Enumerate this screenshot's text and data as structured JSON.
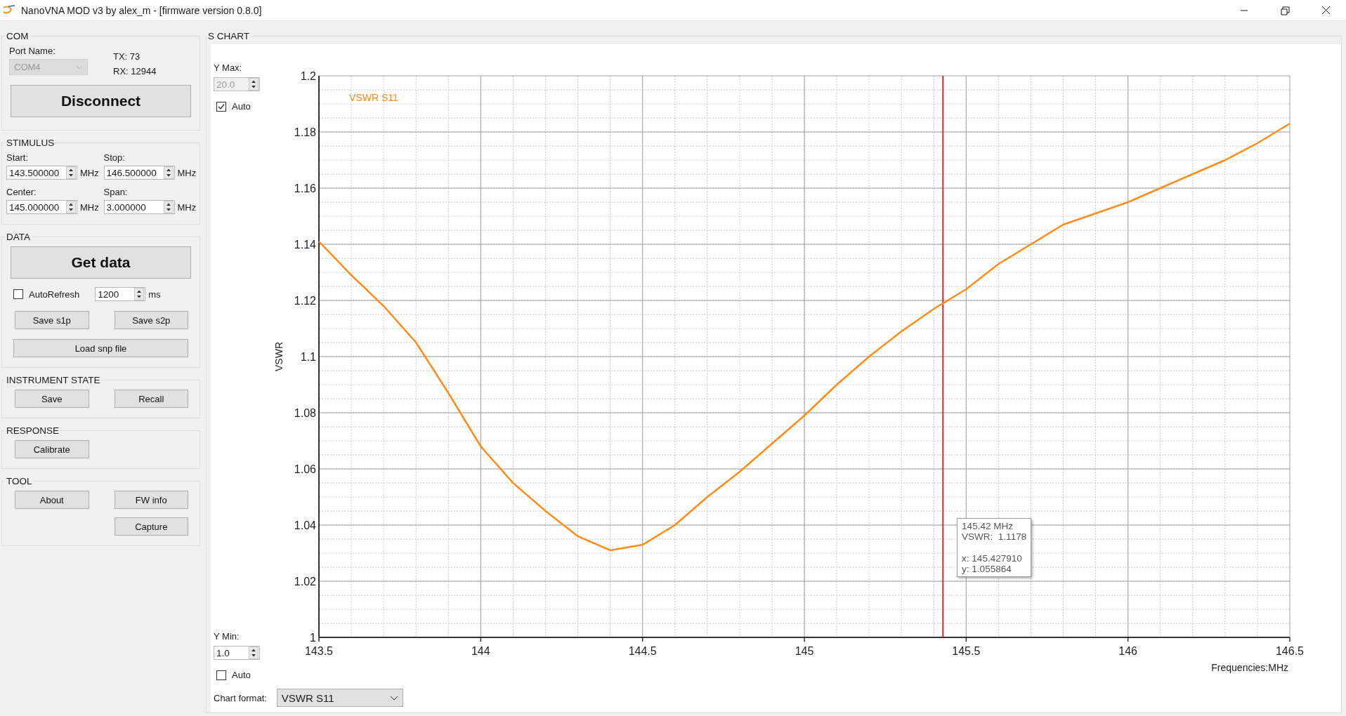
{
  "window": {
    "title": "NanoVNA MOD v3 by alex_m - [firmware version 0.8.0]"
  },
  "com": {
    "title": "COM",
    "port_label": "Port Name:",
    "port_value": "COM4",
    "port_disabled": true,
    "tx": "TX: 73",
    "rx": "RX: 12944",
    "button": "Disconnect"
  },
  "stimulus": {
    "title": "STIMULUS",
    "fields": [
      {
        "label": "Start:",
        "value": "143.500000",
        "unit": "MHz"
      },
      {
        "label": "Stop:",
        "value": "146.500000",
        "unit": "MHz"
      },
      {
        "label": "Center:",
        "value": "145.000000",
        "unit": "MHz"
      },
      {
        "label": "Span:",
        "value": "3.000000",
        "unit": "MHz"
      }
    ]
  },
  "data": {
    "title": "DATA",
    "get_button": "Get data",
    "autorefresh": {
      "label": "AutoRefresh",
      "checked": false
    },
    "interval": {
      "value": "1200",
      "unit": "ms"
    },
    "save_buttons": [
      "Save s1p",
      "Save s2p"
    ],
    "load_button": "Load snp file"
  },
  "instrument_state": {
    "title": "INSTRUMENT STATE",
    "buttons": [
      "Save",
      "Recall"
    ]
  },
  "response": {
    "title": "RESPONSE",
    "buttons": [
      "Calibrate"
    ]
  },
  "tool": {
    "title": "TOOL",
    "rows": [
      {
        "left": "About",
        "right": "FW info"
      },
      {
        "right": "Capture"
      }
    ]
  },
  "chart_panel": {
    "title": "S CHART",
    "y_max": {
      "label": "Y Max:",
      "value": "20.0",
      "disabled": true,
      "auto_label": "Auto",
      "auto_checked": true
    },
    "y_min": {
      "label": "Y Min:",
      "value": "1.0",
      "disabled": false,
      "auto_label": "Auto",
      "auto_checked": false
    },
    "chart_data": {
      "type": "line",
      "xlabel": "Frequencies:MHz",
      "ylabel": "VSWR",
      "x": [
        143.5,
        143.6,
        143.7,
        143.8,
        143.9,
        144.0,
        144.1,
        144.2,
        144.3,
        144.4,
        144.5,
        144.6,
        144.7,
        144.8,
        144.9,
        145.0,
        145.1,
        145.2,
        145.3,
        145.4,
        145.5,
        145.6,
        145.7,
        145.8,
        145.9,
        146.0,
        146.1,
        146.2,
        146.3,
        146.4,
        146.5
      ],
      "series": [
        {
          "name": "VSWR S11",
          "color": "#ff8c1a",
          "values": [
            1.141,
            1.129,
            1.118,
            1.105,
            1.087,
            1.068,
            1.055,
            1.045,
            1.036,
            1.031,
            1.033,
            1.04,
            1.05,
            1.059,
            1.069,
            1.079,
            1.09,
            1.1,
            1.109,
            1.117,
            1.124,
            1.133,
            1.14,
            1.147,
            1.151,
            1.155,
            1.16,
            1.165,
            1.17,
            1.176,
            1.183
          ]
        }
      ],
      "xlim": [
        143.5,
        146.5
      ],
      "ylim": [
        1,
        1.2
      ],
      "xticks": [
        143.5,
        144,
        144.5,
        145,
        145.5,
        146,
        146.5
      ],
      "yticks": [
        1,
        1.02,
        1.04,
        1.06,
        1.08,
        1.1,
        1.12,
        1.14,
        1.16,
        1.18,
        1.2
      ],
      "grid": true,
      "ref_lines": [
        {
          "axis": "x",
          "value": 145.42791,
          "color": "#e00000"
        }
      ]
    },
    "tooltip": {
      "lines": [
        "145.42 MHz",
        "VSWR:  1.1178"
      ],
      "coords": [
        "x: 145.427910",
        "y: 1.055864"
      ]
    },
    "chart_format": {
      "label": "Chart format:",
      "value": "VSWR S11"
    }
  }
}
